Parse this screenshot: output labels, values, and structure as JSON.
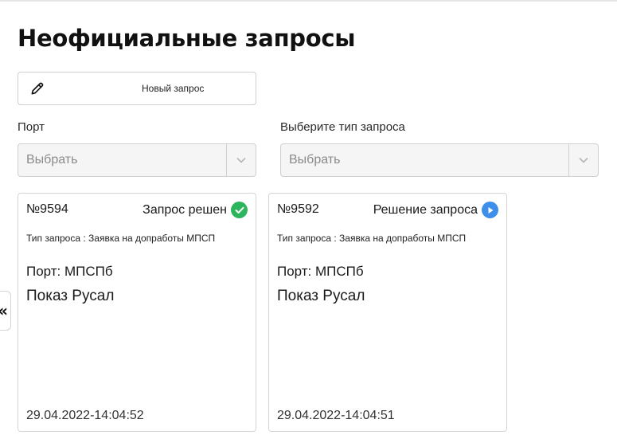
{
  "page": {
    "title": "Неофициальные запросы"
  },
  "toolbar": {
    "new_request_label": "Новый запрос"
  },
  "filters": {
    "port": {
      "label": "Порт",
      "value": "Выбрать"
    },
    "request_type": {
      "label": "Выберите тип запроса",
      "value": "Выбрать"
    }
  },
  "side_toggle": {
    "glyph": "«"
  },
  "cards": [
    {
      "number": "№9594",
      "status": "Запрос решен",
      "status_icon": "check-circle-icon",
      "status_color": "#2db55d",
      "type": "Тип запроса : Заявка на допработы МПСП",
      "port": "Порт: МПСПб",
      "name": "Показ Русал",
      "date": "29.04.2022-14:04:52"
    },
    {
      "number": "№9592",
      "status": "Решение запроса",
      "status_icon": "play-circle-icon",
      "status_color": "#3d8fea",
      "type": "Тип запроса : Заявка на допработы МПСП",
      "port": "Порт: МПСПб",
      "name": "Показ Русал",
      "date": "29.04.2022-14:04:51"
    }
  ]
}
